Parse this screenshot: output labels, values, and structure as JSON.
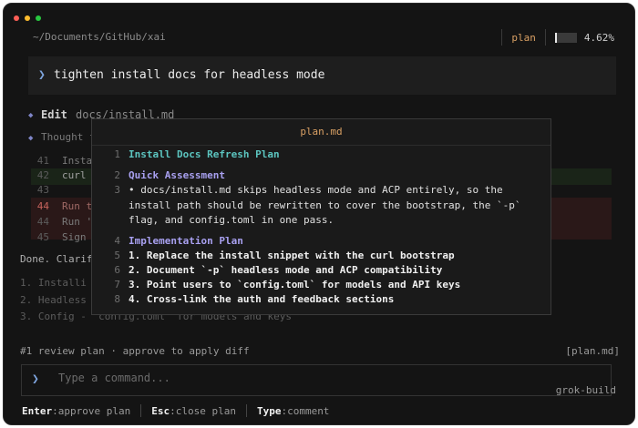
{
  "window": {
    "path": "~/Documents/GitHub/xai",
    "mode": "plan",
    "usage_percent": "4.62%",
    "usage_fraction": 0.0462,
    "lights": {
      "close": "#ff5f57",
      "minimize": "#febc2e",
      "zoom": "#28c840"
    }
  },
  "prompt": {
    "text": "tighten install docs for headless mode"
  },
  "background": {
    "edit_label": "Edit",
    "edit_file": "docs/install.md",
    "thought_prefix": "Thought f",
    "lines": [
      {
        "n": "41",
        "t": "Insta"
      },
      {
        "n": "42",
        "t": "curl"
      },
      {
        "n": "43",
        "t": ""
      },
      {
        "n": "44",
        "t": "Run th"
      },
      {
        "n": "44",
        "t": "Run 's"
      },
      {
        "n": "45",
        "t": "Sign"
      }
    ],
    "done": "Done. Clarif",
    "list": [
      "1. Installi -",
      "2. Headless",
      "3. Config - `config.toml` for models and keys"
    ]
  },
  "modal": {
    "title": "plan.md",
    "rows": [
      {
        "n": "1",
        "t": "Install Docs Refresh Plan",
        "style": "cyan"
      },
      {
        "n": "2",
        "t": "Quick Assessment",
        "style": "purple"
      },
      {
        "n": "3",
        "t": "• docs/install.md skips headless mode and ACP entirely, so the install path should be rewritten to cover the bootstrap, the `-p` flag, and config.toml in one pass.",
        "style": "plain"
      },
      {
        "n": "4",
        "t": "Implementation Plan",
        "style": "purple"
      },
      {
        "n": "5",
        "t": "1. Replace the install snippet with the curl bootstrap",
        "style": "bold"
      },
      {
        "n": "6",
        "t": "2. Document `-p` headless mode and ACP compatibility",
        "style": "bold"
      },
      {
        "n": "7",
        "t": "3. Point users to `config.toml` for models and API keys",
        "style": "bold"
      },
      {
        "n": "8",
        "t": "4. Cross-link the auth and feedback sections",
        "style": "bold"
      }
    ]
  },
  "status": {
    "left": "#1 review plan · approve to apply diff",
    "right": "[plan.md]"
  },
  "command": {
    "placeholder": "Type a command...",
    "footer_label": "grok-build"
  },
  "hints": [
    {
      "key": "Enter",
      "action": ":approve plan"
    },
    {
      "key": "Esc",
      "action": ":close plan"
    },
    {
      "key": "Type",
      "action": ":comment"
    }
  ]
}
